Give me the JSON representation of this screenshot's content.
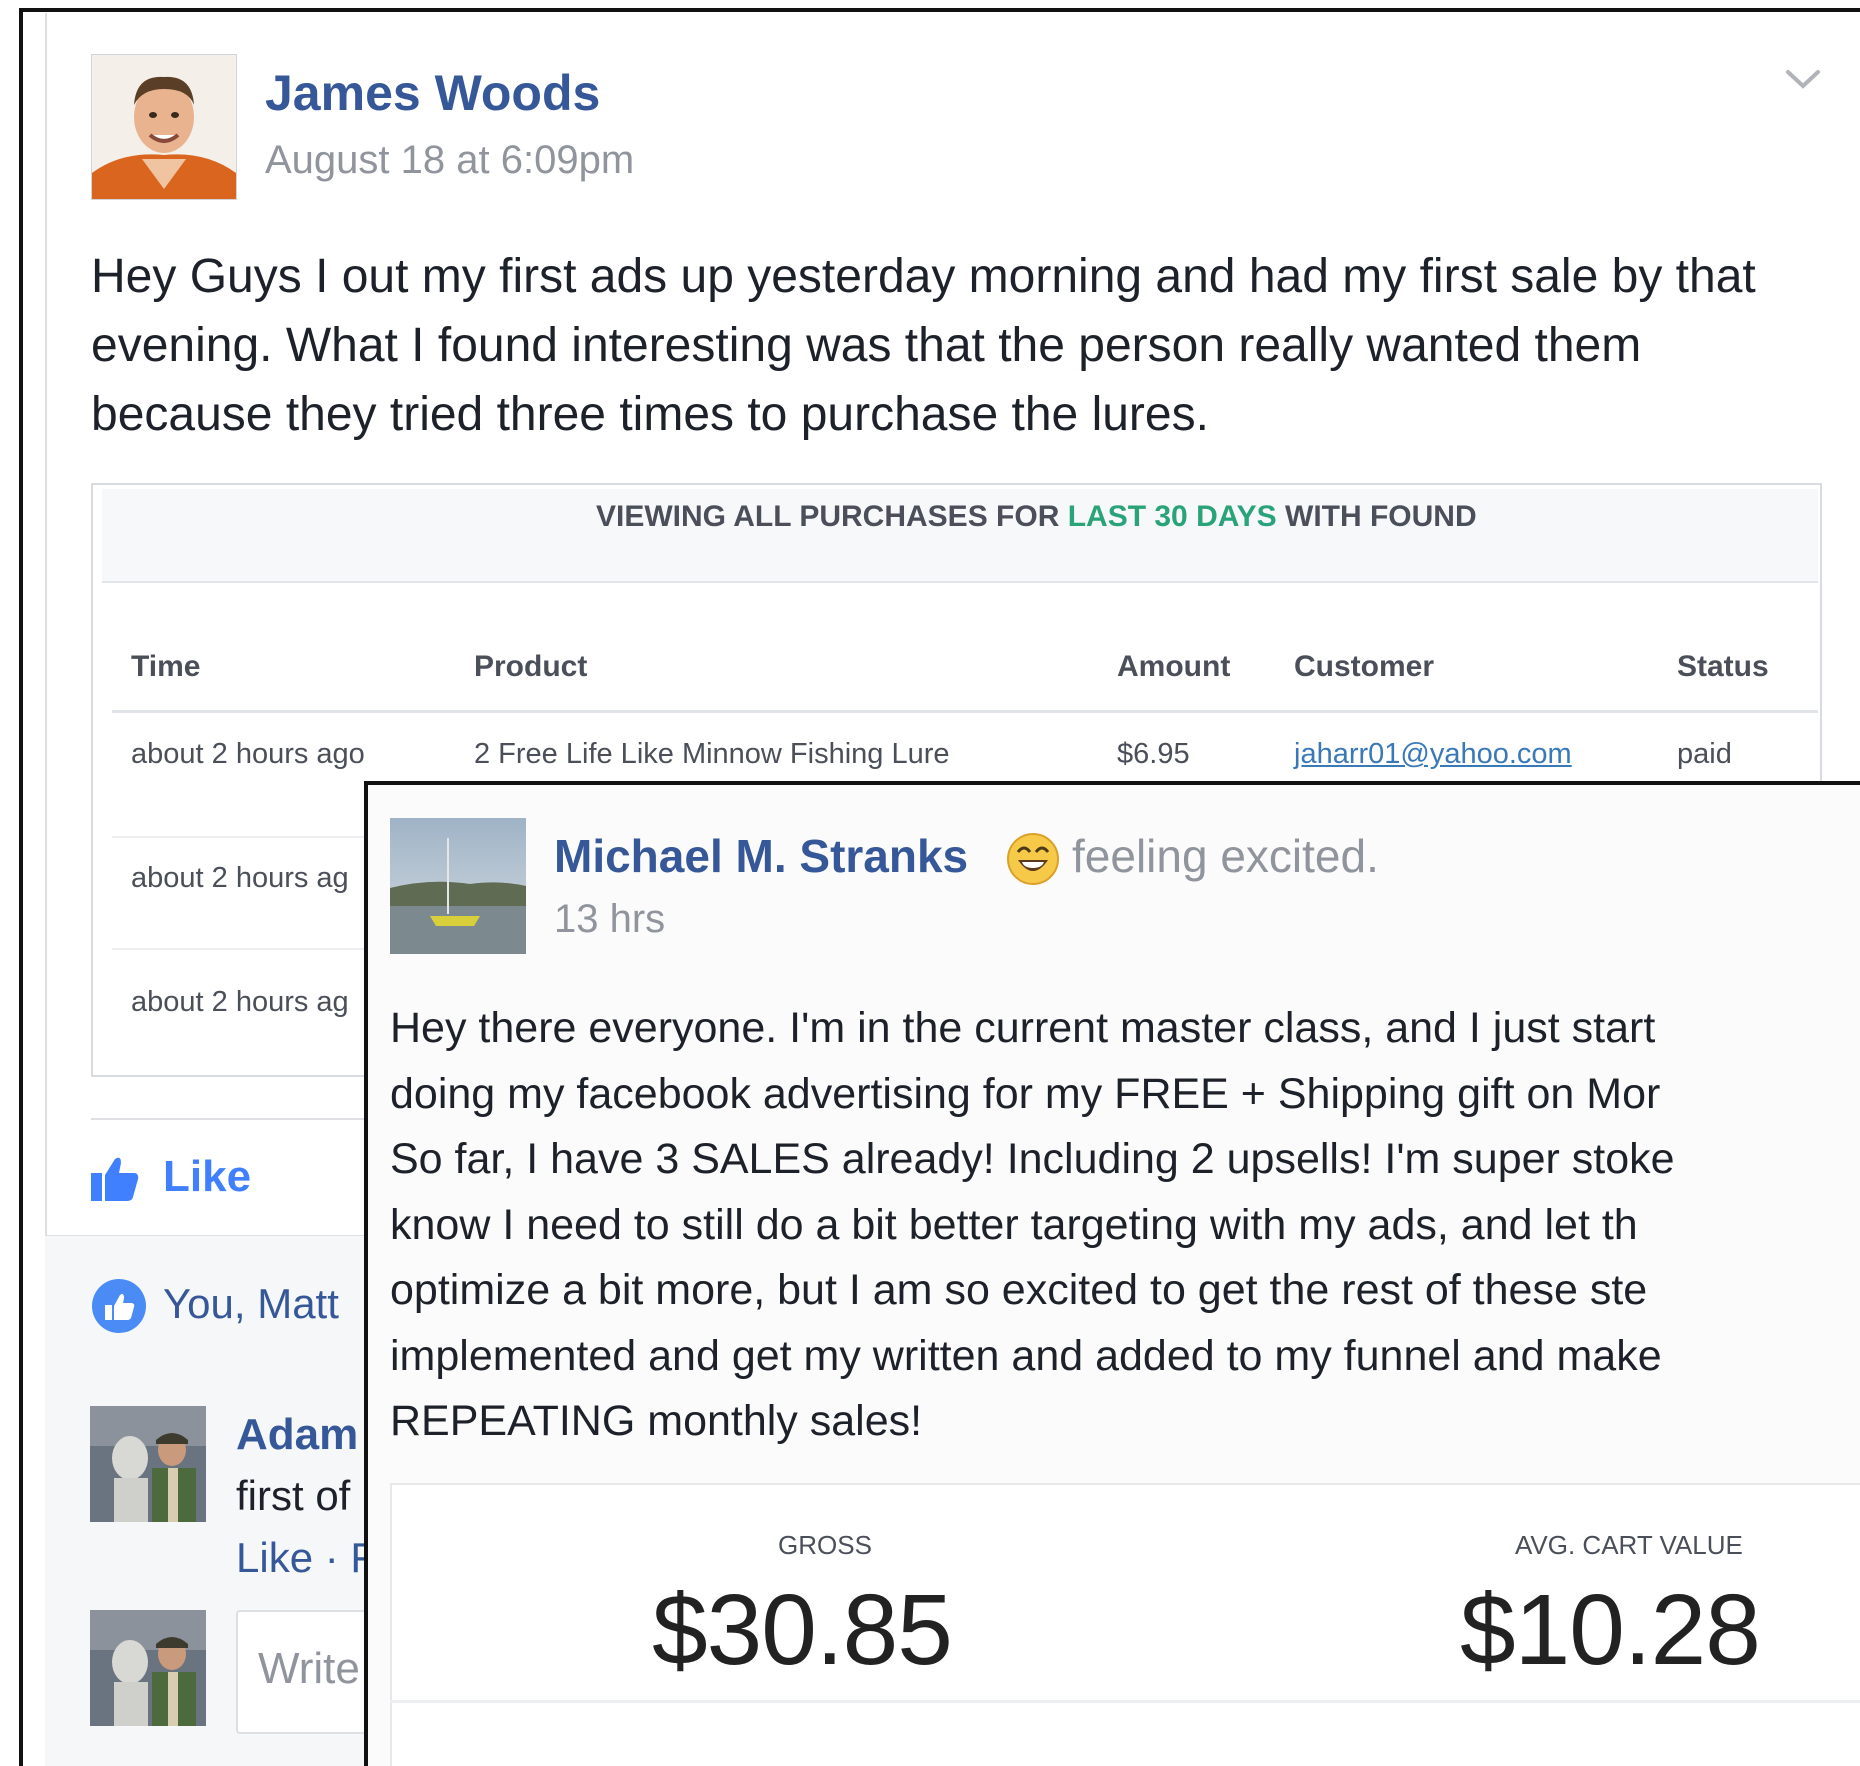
{
  "main_post": {
    "author": "James Woods",
    "timestamp": "August 18 at 6:09pm",
    "body": "Hey Guys I out my first ads up yesterday morning and had my first sale by that evening. What I found interesting was that the person really wanted them because they tried three times to purchase the lures."
  },
  "purchases": {
    "banner_prefix": "VIEWING ALL PURCHASES FOR ",
    "banner_highlight": "LAST 30 DAYS",
    "banner_suffix": " WITH FOUND",
    "highlight_color": "#2aa378",
    "columns": [
      "Time",
      "Product",
      "Amount",
      "Customer",
      "Status"
    ],
    "rows": [
      {
        "time": "about 2 hours ago",
        "product": "2 Free Life Like Minnow Fishing Lure",
        "amount": "$6.95",
        "customer": "jaharr01@yahoo.com",
        "status": "paid"
      },
      {
        "time": "about 2 hours ag"
      },
      {
        "time": "about 2 hours ag"
      }
    ]
  },
  "actions": {
    "like_label": "Like",
    "reactions_text": "You, Matt"
  },
  "comments": [
    {
      "author": "Adam",
      "text": "first of",
      "actions": "Like · F"
    }
  ],
  "composer": {
    "placeholder": "Write"
  },
  "overlay_post": {
    "author": "Michael M. Stranks",
    "feeling": "feeling excited.",
    "timestamp": "13 hrs",
    "body_lines": [
      "Hey there everyone. I'm in the current master class, and I just start",
      "doing my facebook advertising for my FREE + Shipping gift on Mor",
      "So far, I have 3 SALES already! Including 2 upsells! I'm super stoke",
      "know I need to still do a bit better targeting with my ads, and let th",
      "optimize a bit more, but I am so excited to get the rest of these ste",
      "implemented and get my written and added to my funnel and make",
      "REPEATING monthly sales!"
    ],
    "stats": [
      {
        "label": "GROSS",
        "value": "$30.85"
      },
      {
        "label": "AVG. CART VALUE",
        "value": "$10.28"
      }
    ]
  },
  "icons": {
    "chevron": "chevron-down-icon",
    "like": "thumbs-up-icon",
    "reactions": "like-reaction-icon",
    "emoji": "excited-emoji-icon"
  },
  "colors": {
    "link_blue": "#365899",
    "like_blue": "#4080ff",
    "meta_gray": "#90949c"
  }
}
